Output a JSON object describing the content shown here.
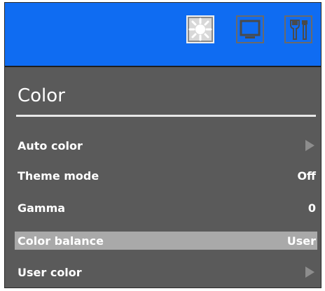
{
  "tabs": [
    {
      "icon": "sun-icon",
      "active": true
    },
    {
      "icon": "monitor-icon",
      "active": false
    },
    {
      "icon": "tools-icon",
      "active": false
    }
  ],
  "title": "Color",
  "menu": [
    {
      "label": "Auto color",
      "value": "",
      "arrow": true,
      "selected": false
    },
    {
      "label": "Theme mode",
      "value": "Off",
      "arrow": false,
      "selected": false
    },
    {
      "label": "Gamma",
      "value": "0",
      "arrow": false,
      "selected": false
    },
    {
      "label": "Color balance",
      "value": "User",
      "arrow": false,
      "selected": true
    },
    {
      "label": "User color",
      "value": "",
      "arrow": true,
      "selected": false
    }
  ],
  "colors": {
    "topbar": "#0f6cf2",
    "panel": "#5a5a5a",
    "highlight": "#a9a9a9"
  }
}
